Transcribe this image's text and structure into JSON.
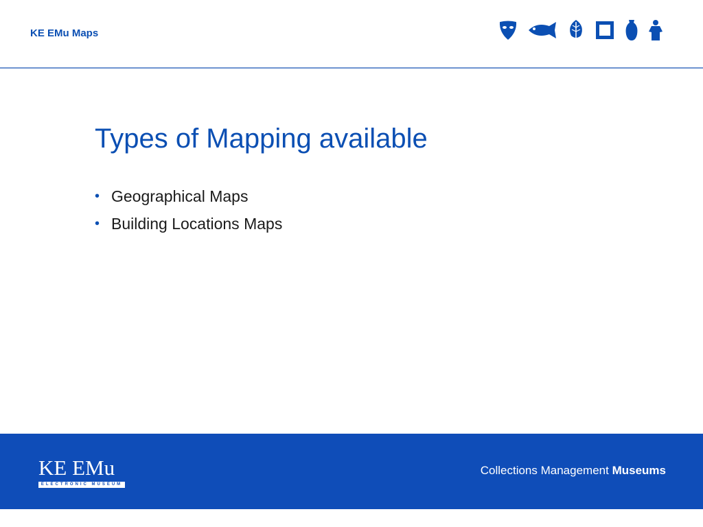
{
  "header": {
    "title": "KE EMu Maps",
    "icons": [
      "mask-icon",
      "fish-icon",
      "leaf-icon",
      "frame-icon",
      "vase-icon",
      "statue-icon"
    ],
    "accent_color": "#0b4fb3"
  },
  "slide": {
    "title": "Types of Mapping available",
    "bullets": [
      "Geographical Maps",
      "Building Locations Maps"
    ]
  },
  "footer": {
    "logo_text": "KE EMu",
    "logo_subtext": "ELECTRONIC MUSEUM",
    "tagline_regular": "Collections Management",
    "tagline_bold": "Museums",
    "background_color": "#0f4db8"
  }
}
